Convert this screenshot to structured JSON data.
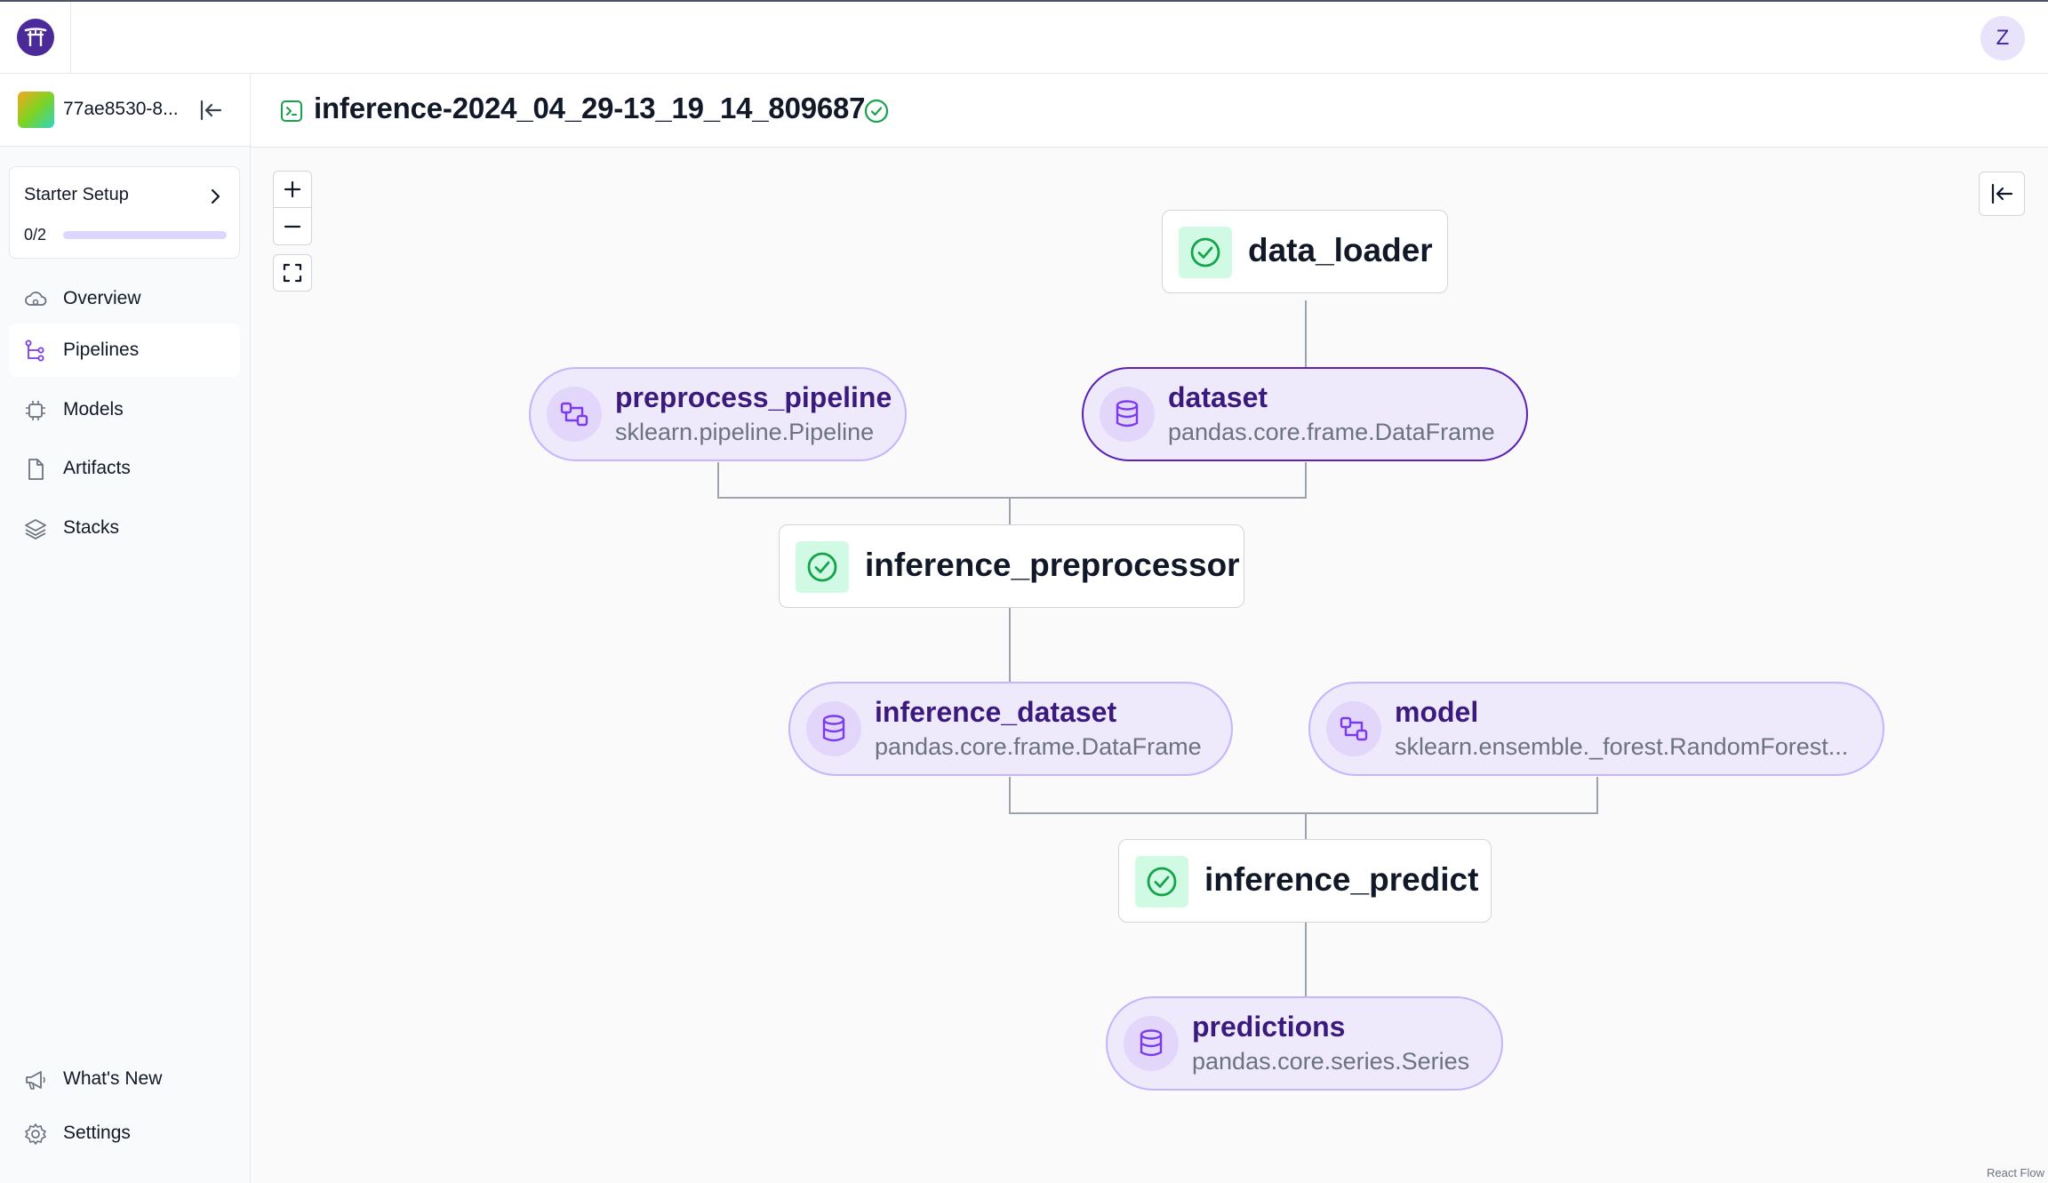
{
  "header": {
    "avatar_initial": "Z"
  },
  "sidebar": {
    "workspace_name": "77ae8530-8...",
    "starter": {
      "title": "Starter Setup",
      "progress_text": "0/2",
      "progress_fraction": 0
    },
    "items": [
      {
        "label": "Overview",
        "icon": "cloud-icon"
      },
      {
        "label": "Pipelines",
        "icon": "pipeline-icon",
        "active": true
      },
      {
        "label": "Models",
        "icon": "chip-icon"
      },
      {
        "label": "Artifacts",
        "icon": "file-icon"
      },
      {
        "label": "Stacks",
        "icon": "layers-icon"
      }
    ],
    "bottom_items": [
      {
        "label": "What's New",
        "icon": "megaphone-icon"
      },
      {
        "label": "Settings",
        "icon": "gear-icon"
      }
    ]
  },
  "run": {
    "title": "inference-2024_04_29-13_19_14_809687",
    "status": "completed"
  },
  "graph": {
    "steps": [
      {
        "name": "data_loader",
        "status": "completed"
      },
      {
        "name": "inference_preprocessor",
        "status": "completed"
      },
      {
        "name": "inference_predict",
        "status": "completed"
      }
    ],
    "artifacts": [
      {
        "name": "preprocess_pipeline",
        "type": "sklearn.pipeline.Pipeline",
        "icon": "pipeline-artifact-icon"
      },
      {
        "name": "dataset",
        "type": "pandas.core.frame.DataFrame",
        "icon": "database-icon"
      },
      {
        "name": "inference_dataset",
        "type": "pandas.core.frame.DataFrame",
        "icon": "database-icon"
      },
      {
        "name": "model",
        "type": "sklearn.ensemble._forest.RandomForest...",
        "icon": "pipeline-artifact-icon"
      },
      {
        "name": "predictions",
        "type": "pandas.core.series.Series",
        "icon": "database-icon"
      }
    ]
  },
  "canvas": {
    "attribution": "React Flow"
  },
  "colors": {
    "accent": "#5b21b6",
    "artifact_bg": "#efe9fc",
    "success": "#16a34a"
  }
}
